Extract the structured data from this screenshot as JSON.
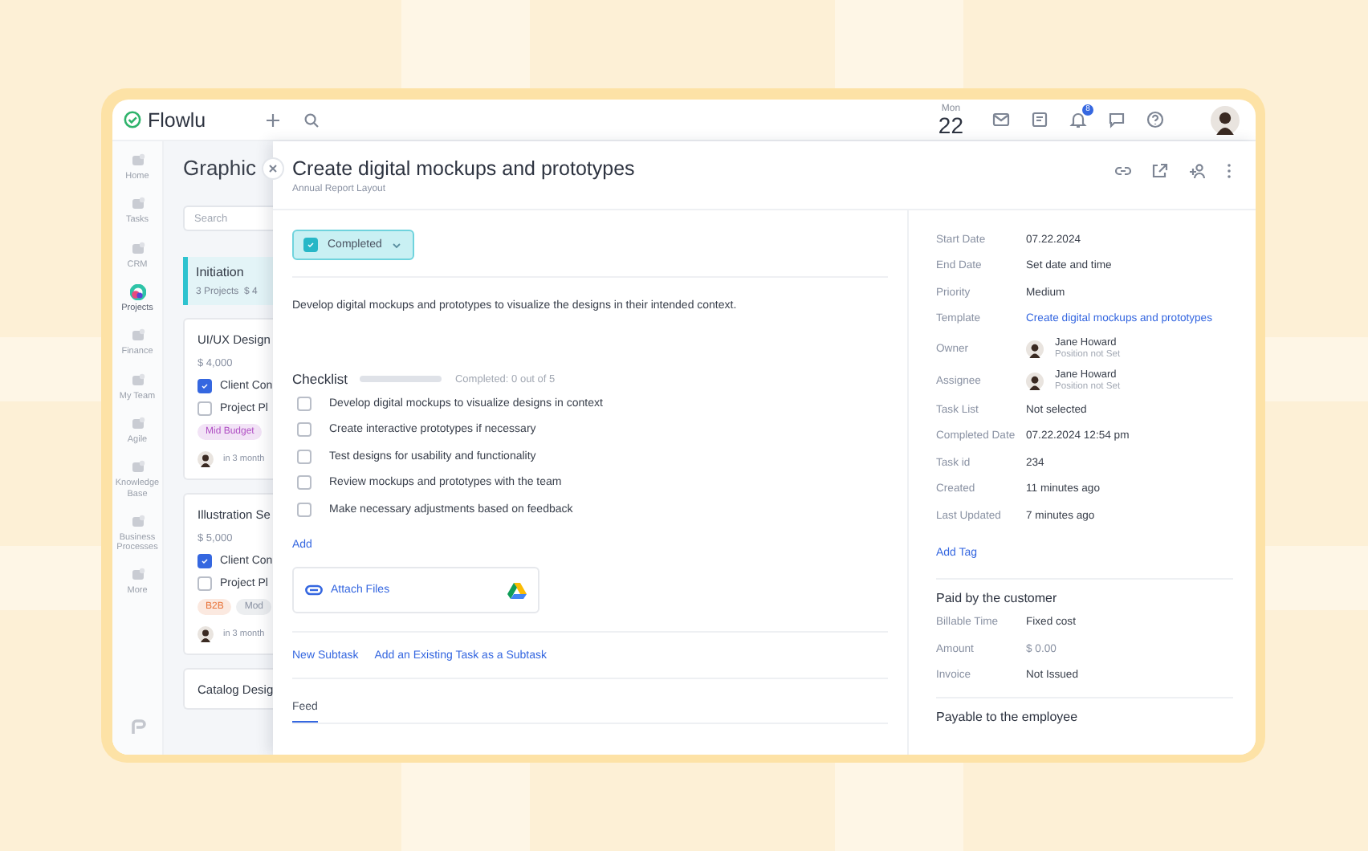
{
  "topbar": {
    "logo": "Flowlu",
    "day_name": "Mon",
    "day_number": "22",
    "notification_count": "8"
  },
  "nav": {
    "items": [
      {
        "label": "Home",
        "selected": false
      },
      {
        "label": "Tasks",
        "selected": false
      },
      {
        "label": "CRM",
        "selected": false
      },
      {
        "label": "Projects",
        "selected": true
      },
      {
        "label": "Finance",
        "selected": false
      },
      {
        "label": "My Team",
        "selected": false
      },
      {
        "label": "Agile",
        "selected": false
      },
      {
        "label": "Knowledge Base",
        "selected": false
      },
      {
        "label": "Business Processes",
        "selected": false
      },
      {
        "label": "More",
        "selected": false
      }
    ]
  },
  "board": {
    "title": "Graphic",
    "search": {
      "placeholder": "Search"
    },
    "stage": {
      "name": "Initiation",
      "summary": "3 Projects  $ 4"
    },
    "cards": [
      {
        "title": "UI/UX Design",
        "amount": "$ 4,000",
        "checklist": [
          {
            "label": "Client Con",
            "checked": true
          },
          {
            "label": "Project Pl",
            "checked": false
          }
        ],
        "tags": [
          {
            "label": "Mid Budget",
            "color": "#b04fc4"
          }
        ],
        "due": "in 3 month"
      },
      {
        "title": "Illustration Se",
        "amount": "$ 5,000",
        "checklist": [
          {
            "label": "Client Con",
            "checked": true
          },
          {
            "label": "Project Pl",
            "checked": false
          }
        ],
        "tags": [
          {
            "label": "B2B",
            "color": "#e8743b"
          },
          {
            "label": "Mod",
            "color": "#8a92a3"
          }
        ],
        "due": "in 3 month"
      },
      {
        "title": "Catalog Desig"
      }
    ]
  },
  "panel": {
    "title": "Create digital mockups and prototypes",
    "subtitle": "Annual Report Layout",
    "status": {
      "label": "Completed",
      "checked": true
    },
    "description": "Develop digital mockups and prototypes to visualize the designs in their intended context.",
    "checklist": {
      "title": "Checklist",
      "level": 0,
      "summary": "Completed: 0 out of 5",
      "add": "Add",
      "items": [
        {
          "label": "Develop digital mockups to visualize designs in context",
          "checked": false
        },
        {
          "label": "Create interactive prototypes if necessary",
          "checked": false
        },
        {
          "label": "Test designs for usability and functionality",
          "checked": false
        },
        {
          "label": "Review mockups and prototypes with the team",
          "checked": false
        },
        {
          "label": "Make necessary adjustments based on feedback",
          "checked": false
        }
      ]
    },
    "attach": "Attach Files",
    "subtask_links": [
      "New Subtask",
      "Add an Existing Task as a Subtask"
    ],
    "tabs": [
      {
        "label": "Feed",
        "selected": true
      }
    ],
    "details": [
      {
        "kind": "text",
        "label": "Start Date",
        "value": "07.22.2024"
      },
      {
        "kind": "text",
        "label": "End Date",
        "value": "Set date and time"
      },
      {
        "kind": "text",
        "label": "Priority",
        "value": "Medium"
      },
      {
        "kind": "link",
        "label": "Template",
        "value": "Create digital mockups and prototypes"
      },
      {
        "kind": "person",
        "label": "Owner",
        "value": "Jane Howard",
        "position": "Position not Set"
      },
      {
        "kind": "person",
        "label": "Assignee",
        "value": "Jane Howard",
        "position": "Position not Set"
      },
      {
        "kind": "text",
        "label": "Task List",
        "value": "Not selected"
      },
      {
        "kind": "text",
        "label": "Completed Date",
        "value": "07.22.2024 12:54 pm"
      },
      {
        "kind": "text",
        "label": "Task id",
        "value": "234"
      },
      {
        "kind": "text",
        "label": "Created",
        "value": "11 minutes ago"
      },
      {
        "kind": "text",
        "label": "Last Updated",
        "value": "7 minutes ago"
      }
    ],
    "add_tag": "Add Tag",
    "sections": [
      {
        "title": "Paid by the customer",
        "rows": [
          {
            "kind": "text",
            "label": "Billable Time",
            "value": "Fixed cost"
          },
          {
            "kind": "muted",
            "label": "Amount",
            "value": "$ 0.00"
          },
          {
            "kind": "text",
            "label": "Invoice",
            "value": "Not Issued"
          }
        ]
      },
      {
        "title": "Payable to the employee"
      }
    ]
  }
}
